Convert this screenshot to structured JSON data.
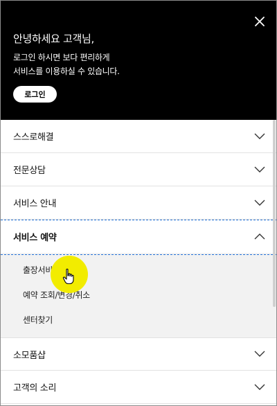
{
  "header": {
    "greeting": "안녕하세요 고객님,",
    "subtext_line1": "로그인 하시면 보다 편리하게",
    "subtext_line2": "서비스를 이용하실 수 있습니다.",
    "login_label": "로그인",
    "close_icon": "close-icon"
  },
  "menu": {
    "items": [
      {
        "label": "스스로해결",
        "expanded": false
      },
      {
        "label": "전문상담",
        "expanded": false
      },
      {
        "label": "서비스 안내",
        "expanded": false
      },
      {
        "label": "서비스 예약",
        "expanded": true,
        "children": [
          "출장서비스 예약",
          "예약 조회/변경/취소",
          "센터찾기"
        ]
      },
      {
        "label": "소모품샵",
        "expanded": false
      },
      {
        "label": "고객의 소리",
        "expanded": false
      }
    ]
  },
  "colors": {
    "header_bg": "#000000",
    "highlight_border": "#1f6fd6",
    "submenu_bg": "#f2f2f2",
    "cursor_halo": "#f2ec00"
  }
}
